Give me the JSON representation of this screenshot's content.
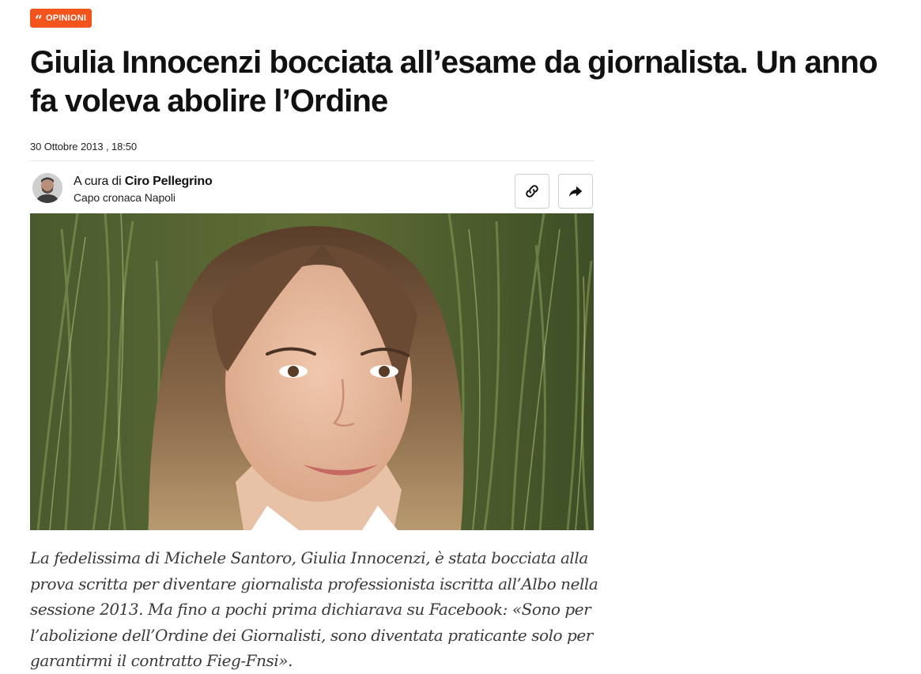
{
  "category": {
    "label": "OPINIONI",
    "icon": "quote-icon",
    "color": "#f2541b"
  },
  "article": {
    "headline": "Giulia Innocenzi bocciata all’esame da giornalista. Un anno fa voleva abolire l’Ordine",
    "timestamp": "30 Ottobre 2013 , 18:50",
    "author": {
      "prefix": "A cura di",
      "name": "Ciro Pellegrino",
      "role": "Capo cronaca Napoli"
    },
    "lead": "La fedelissima di Michele Santoro, Giulia Innocenzi, è stata bocciata alla prova scritta per diventare giornalista professionista iscritta all’Albo nella sessione 2013. Ma fino a pochi prima dichiarava su Facebook: «Sono per l’abolizione dell’Ordine dei Giornalisti, sono diventata praticante solo per garantirmi il contratto Fieg-Fnsi»."
  },
  "actions": {
    "copy_link_icon": "link-icon",
    "share_icon": "share-arrow-icon"
  },
  "colors": {
    "accent": "#f2541b",
    "text": "#111111",
    "lead_text": "#3a3a3a"
  }
}
